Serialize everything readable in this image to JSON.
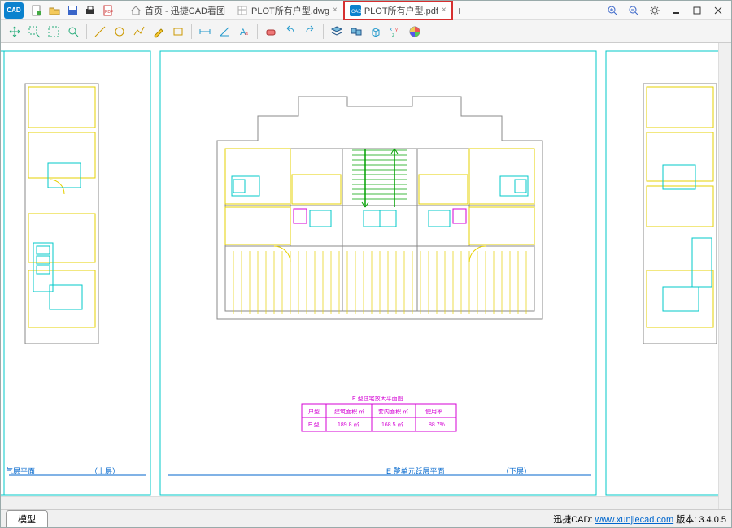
{
  "app": {
    "logo_text": "CAD"
  },
  "tabs": {
    "items": [
      {
        "label": "首页 - 迅捷CAD看图"
      },
      {
        "label": "PLOT所有户型.dwg"
      },
      {
        "label": "PLOT所有户型.pdf"
      }
    ],
    "close": "×",
    "add": "+"
  },
  "toolbar_model_tab": "模型",
  "status": {
    "brand": "迅捷CAD:",
    "url": "www.xunjiecad.com",
    "version_label": "版本:",
    "version": "3.4.0.5"
  },
  "drawing": {
    "title_left": "气层平面",
    "title_left2": "（上层）",
    "title_mid": "E    整单元跃层平面",
    "title_right": "（下层）",
    "table_title": "E 型住宅放大平面图",
    "table": {
      "r1": [
        "户型",
        "建筑面积 ㎡",
        "套内面积 ㎡",
        "使用率"
      ],
      "r2": [
        "E 型",
        "189.8 ㎡",
        "168.5 ㎡",
        "88.7%"
      ]
    }
  }
}
